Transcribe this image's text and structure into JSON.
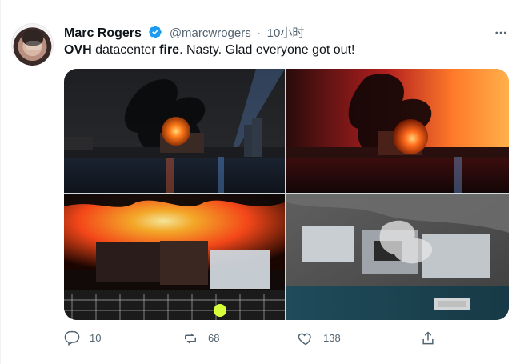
{
  "tweet": {
    "author_name": "Marc Rogers",
    "handle": "@marcwrogers",
    "separator": "·",
    "time": "10小时",
    "text_parts": [
      {
        "text": "OVH",
        "bold": true
      },
      {
        "text": " datacenter ",
        "bold": false
      },
      {
        "text": "fire",
        "bold": true
      },
      {
        "text": ". Nasty. Glad everyone got out!",
        "bold": false
      }
    ],
    "actions": {
      "reply_count": "10",
      "retweet_count": "68",
      "like_count": "138",
      "share_icon": "share-icon"
    },
    "icons": [
      "verified-badge-icon",
      "more-icon",
      "reply-icon",
      "retweet-icon",
      "like-icon",
      "share-icon"
    ],
    "colors": {
      "text": "#0f1419",
      "secondary": "#536471",
      "verified_blue": "#1d9bf0"
    }
  }
}
